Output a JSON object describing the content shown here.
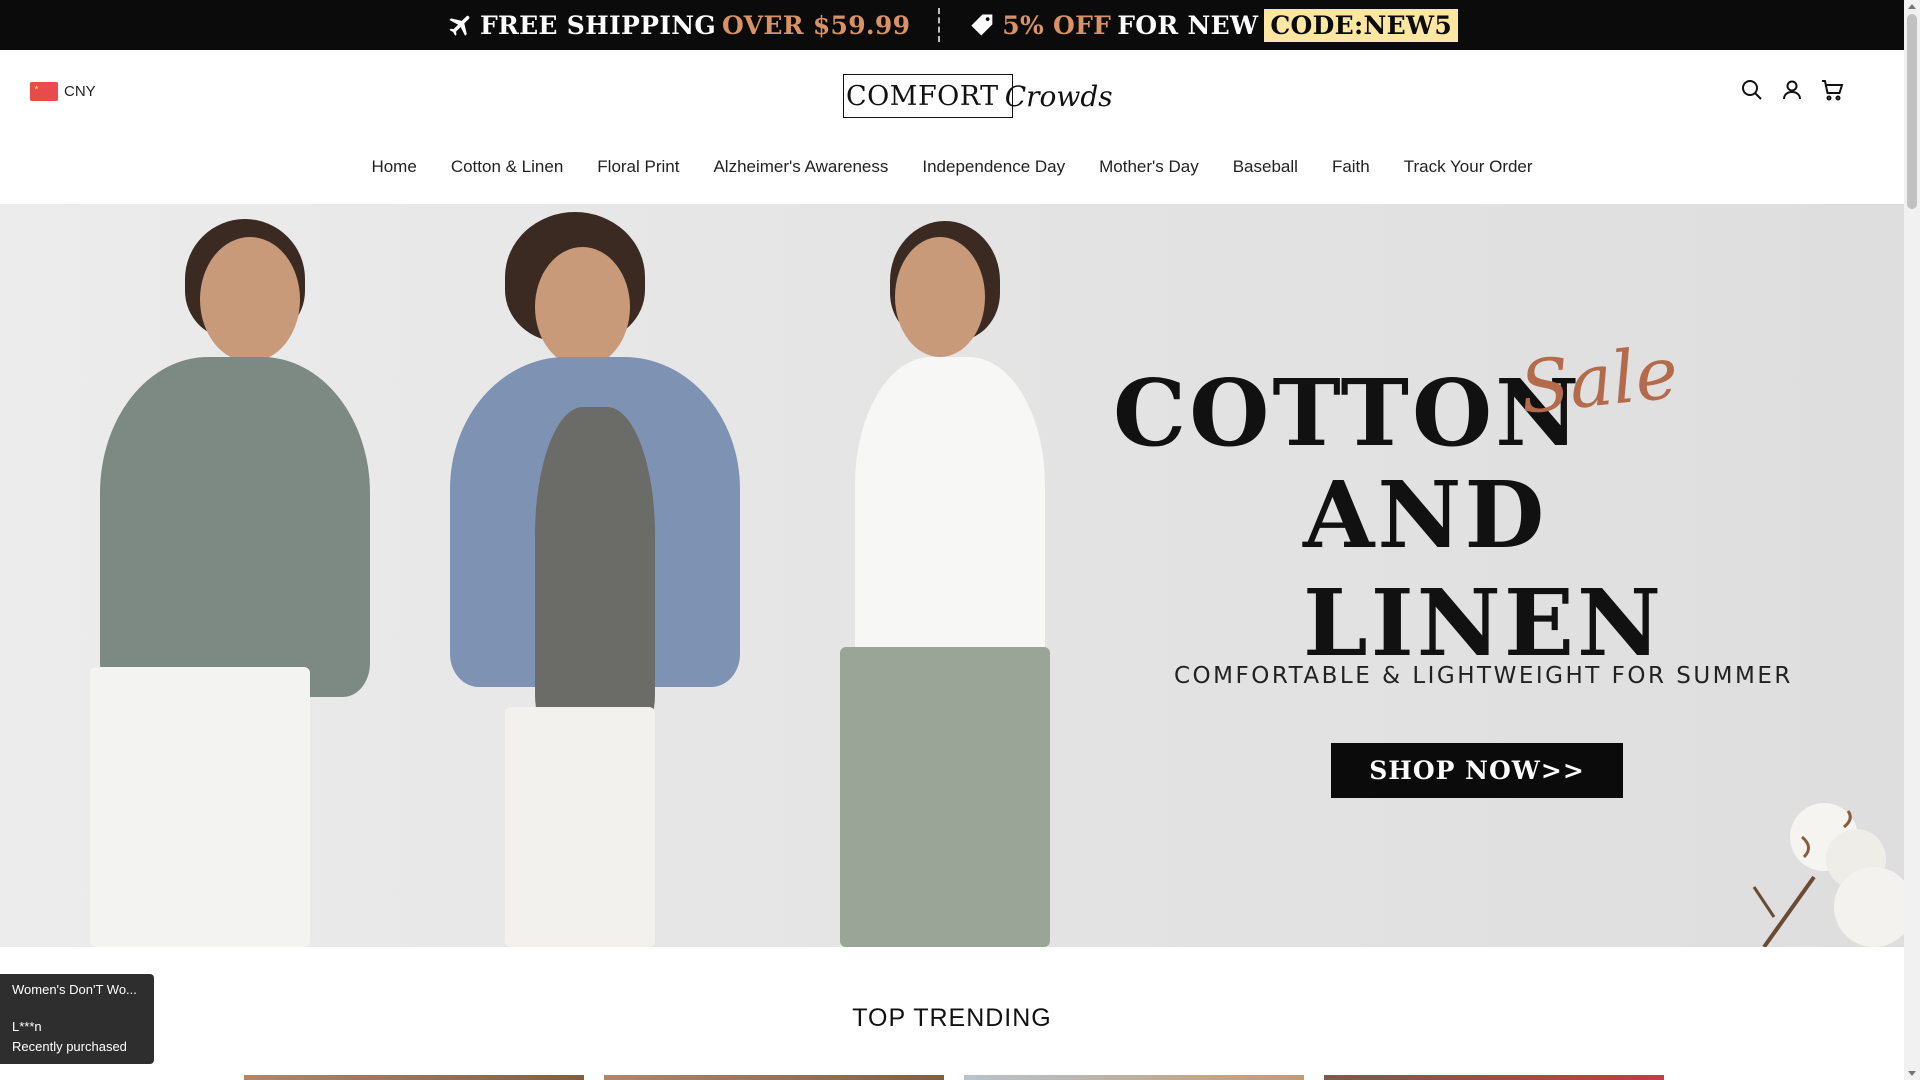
{
  "announcement": {
    "shipping_lead": "FREE SHIPPING",
    "shipping_amount": "OVER $59.99",
    "discount_amount": "5% OFF",
    "discount_text": "FOR NEW",
    "code": "CODE:NEW5",
    "icons": [
      "airplane-icon",
      "tag-icon"
    ]
  },
  "header": {
    "currency": "CNY",
    "logo": {
      "word1": "COMFORT",
      "word2": "Crowds"
    },
    "icons": [
      "search-icon",
      "account-icon",
      "cart-icon"
    ]
  },
  "nav": {
    "items": [
      {
        "label": "Home"
      },
      {
        "label": "Cotton & Linen"
      },
      {
        "label": "Floral Print"
      },
      {
        "label": "Alzheimer's Awareness"
      },
      {
        "label": "Independence Day"
      },
      {
        "label": "Mother's Day"
      },
      {
        "label": "Baseball"
      },
      {
        "label": "Faith"
      },
      {
        "label": "Track Your Order"
      }
    ]
  },
  "hero": {
    "title_line1": "COTTON",
    "script": "Sale",
    "title_line2": "AND LINEN",
    "subtitle": "COMFORTABLE & LIGHTWEIGHT FOR SUMMER",
    "cta": "SHOP NOW>>"
  },
  "trending": {
    "heading": "TOP TRENDING"
  },
  "popup": {
    "product": "Women's Don'T Wo...",
    "customer": "L***n",
    "status": "Recently purchased"
  },
  "colors": {
    "accent": "#d99266",
    "code_bg": "#fbe7a2",
    "script": "#b46b4c",
    "dark": "#0b0b0b"
  }
}
